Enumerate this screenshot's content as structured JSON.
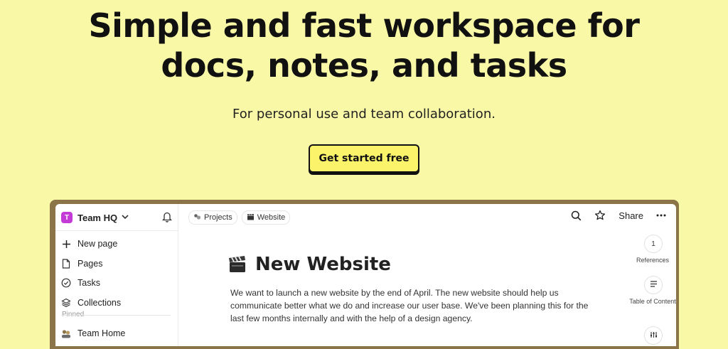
{
  "hero": {
    "title_line1": "Simple and fast workspace for",
    "title_line2": "docs, notes, and tasks",
    "subtitle": "For personal use and team collaboration.",
    "cta_label": "Get started free"
  },
  "colors": {
    "background": "#f9f8a6",
    "cta": "#fbf36a",
    "frame": "#8a7448",
    "workspace_logo": "#c33ad6"
  },
  "app": {
    "workspace": {
      "logo_letter": "T",
      "name": "Team HQ"
    },
    "sidebar": {
      "items": [
        {
          "label": "New page",
          "icon": "plus-icon"
        },
        {
          "label": "Pages",
          "icon": "page-icon"
        },
        {
          "label": "Tasks",
          "icon": "check-circle-icon"
        },
        {
          "label": "Collections",
          "icon": "layers-icon"
        }
      ],
      "pinned_label": "Pinned",
      "pinned_items": [
        {
          "label": "Team Home",
          "icon": "team-icon"
        }
      ]
    },
    "breadcrumbs": [
      {
        "label": "Projects",
        "icon": "projects-icon"
      },
      {
        "label": "Website",
        "icon": "clapper-icon"
      }
    ],
    "toolbar": {
      "share_label": "Share"
    },
    "document": {
      "title": "New Website",
      "body": "We want to launch a new website by the end of April. The new website should help us communicate better what we do and increase our user base. We've been planning this for the last few months internally and with the help of a design agency."
    },
    "rail": {
      "references_count": "1",
      "references_label": "References",
      "toc_label": "Table of Content"
    }
  }
}
